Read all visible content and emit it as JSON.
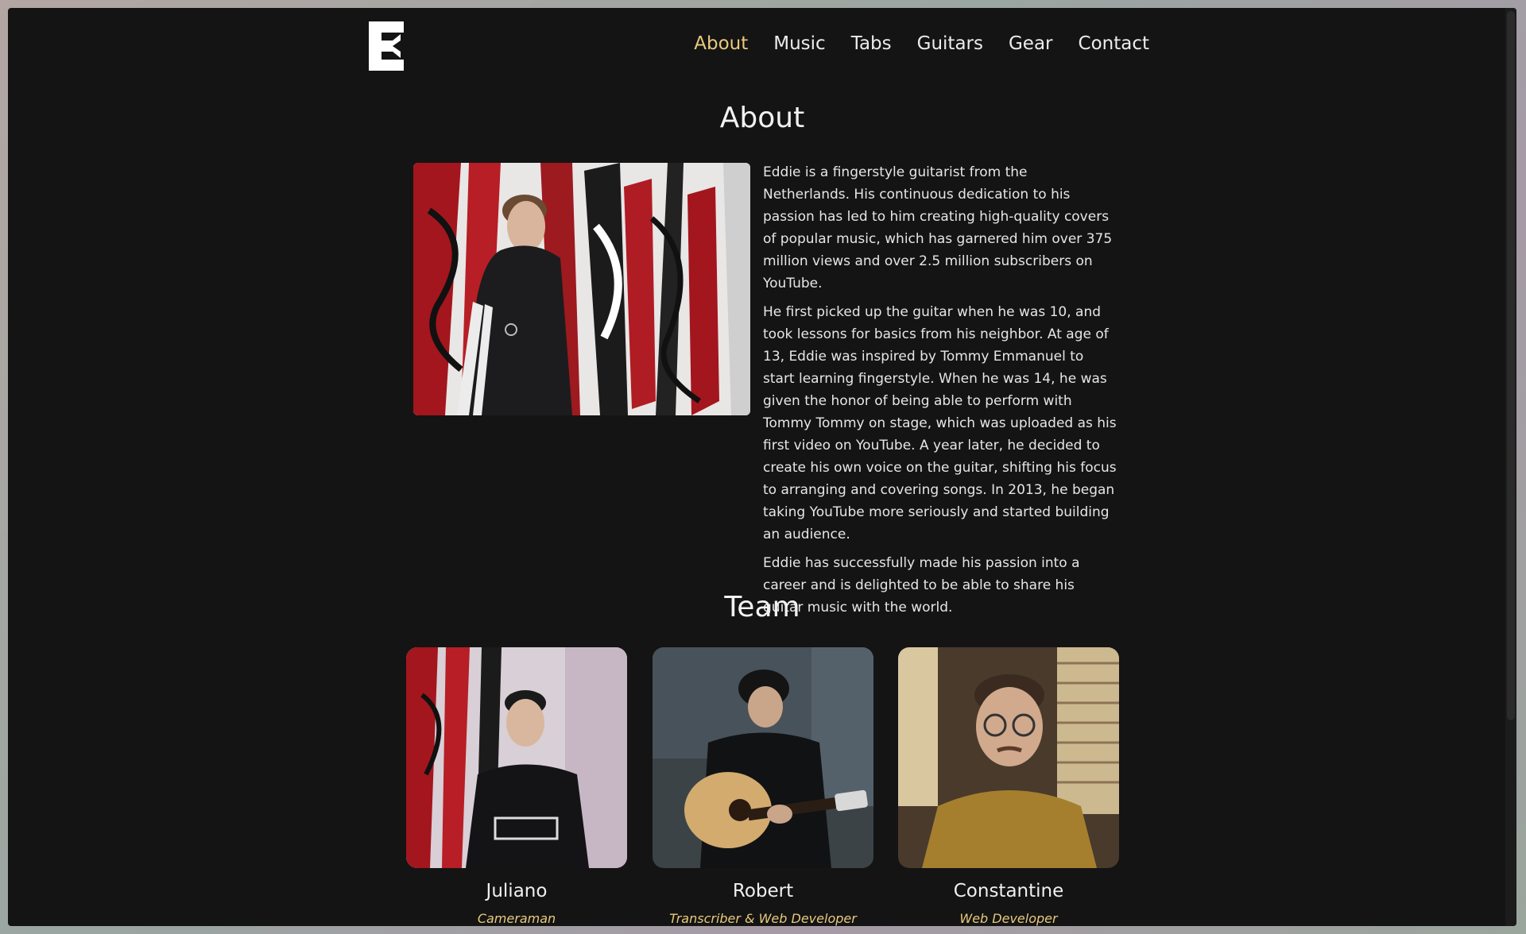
{
  "nav": {
    "items": [
      "About",
      "Music",
      "Tabs",
      "Guitars",
      "Gear",
      "Contact"
    ],
    "active": "About"
  },
  "about": {
    "title": "About",
    "paragraphs": [
      "Eddie is a fingerstyle guitarist from the Netherlands. His continuous dedication to his passion has led to him creating high-quality covers of popular music, which has garnered him over 375 million views and over 2.5 million subscribers on YouTube.",
      "He first picked up the guitar when he was 10, and took lessons for basics from his neighbor. At age of 13, Eddie was inspired by Tommy Emmanuel to start learning fingerstyle. When he was 14, he was given the honor of being able to perform with Tommy Tommy on stage, which was uploaded as his first video on YouTube. A year later, he decided to create his own voice on the guitar, shifting his focus to arranging and covering songs. In 2013, he began taking YouTube more seriously and started building an audience.",
      "Eddie has successfully made his passion into a career and is delighted to be able to share his guitar music with the world."
    ]
  },
  "team": {
    "title": "Team",
    "members": [
      {
        "name": "Juliano",
        "role": "Cameraman"
      },
      {
        "name": "Robert",
        "role": "Transcriber & Web Developer"
      },
      {
        "name": "Constantine",
        "role": "Web Developer"
      }
    ]
  },
  "colors": {
    "background": "#141414",
    "accent": "#e8c97e",
    "text": "#ececec"
  }
}
